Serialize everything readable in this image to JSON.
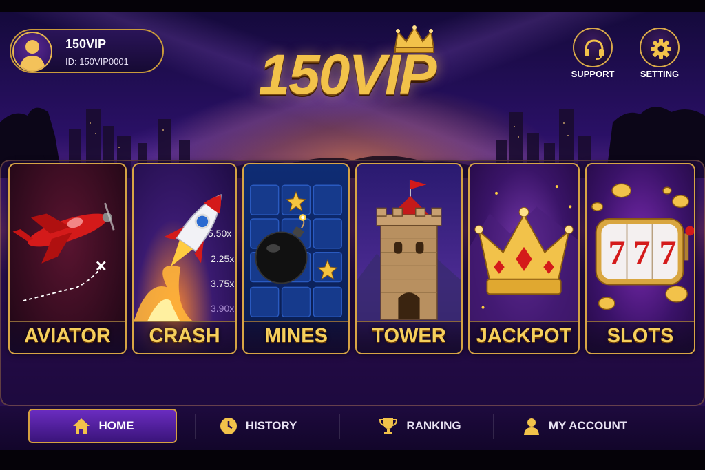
{
  "profile": {
    "name": "150VIP",
    "id_text": "ID: 150VIP0001"
  },
  "logo": {
    "text": "150VIP"
  },
  "top_buttons": {
    "support": "SUPPORT",
    "setting": "SETTING"
  },
  "games": [
    {
      "title": "AVIATOR",
      "icon": "airplane-icon"
    },
    {
      "title": "CRASH",
      "icon": "rocket-icon",
      "multipliers": [
        "5.50x",
        "2.25x",
        "3.75x",
        "3.90x"
      ]
    },
    {
      "title": "MINES",
      "icon": "bomb-icon"
    },
    {
      "title": "TOWER",
      "icon": "castle-tower-icon"
    },
    {
      "title": "JACKPOT",
      "icon": "crown-icon"
    },
    {
      "title": "SLOTS",
      "icon": "slot-machine-icon",
      "reel_symbols": [
        "7",
        "7",
        "7"
      ]
    }
  ],
  "nav": {
    "items": [
      {
        "label": "HOME",
        "icon": "home-icon",
        "active": true
      },
      {
        "label": "HISTORY",
        "icon": "clock-icon",
        "active": false
      },
      {
        "label": "RANKING",
        "icon": "trophy-icon",
        "active": false
      },
      {
        "label": "MY ACCOUNT",
        "icon": "user-icon",
        "active": false
      }
    ]
  },
  "colors": {
    "gold": "#f5cf5c",
    "gold_border": "#d7a545",
    "purple_bg": "#2a1066",
    "active_tab": "#6a2cc0"
  }
}
